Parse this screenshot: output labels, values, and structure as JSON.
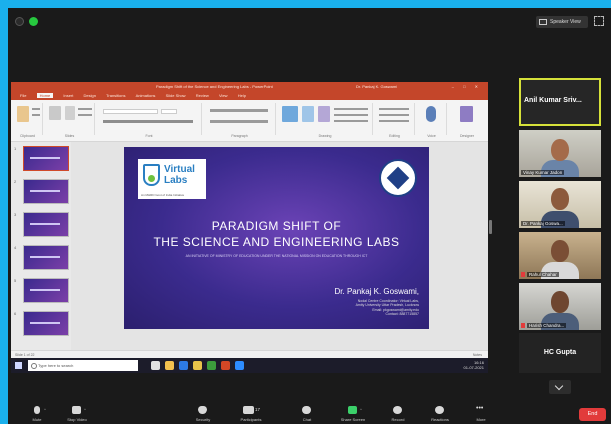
{
  "window": {
    "speaker_view_label": "Speaker View"
  },
  "powerpoint": {
    "doc_title": "Paradigm Shift of the Science and Engineering Labs - PowerPoint",
    "user": "Dr. Pankaj K. Goswami",
    "tabs": [
      "File",
      "Home",
      "Insert",
      "Design",
      "Transitions",
      "Animations",
      "Slide Show",
      "Review",
      "View",
      "Help"
    ],
    "active_tab": "Home",
    "ribbon_groups": [
      "Clipboard",
      "Slides",
      "Font",
      "Paragraph",
      "Drawing",
      "Editing",
      "Voice",
      "Designer"
    ],
    "status_left": "Slide 1 of 22",
    "status_right": "Notes",
    "thumb_numbers": [
      "1",
      "2",
      "3",
      "4",
      "5",
      "6"
    ]
  },
  "slide": {
    "logo_text_1": "Virtual",
    "logo_text_2": "Labs",
    "logo_caption": "An MHRD Govt of India Initiative",
    "title_line1": "PARADIGM SHIFT OF",
    "title_line2": "THE SCIENCE AND ENGINEERING LABS",
    "subtitle": "AN INITIATIVE OF MINISTRY OF EDUCATION UNDER THE NATIONAL MISSION ON EDUCATION THROUGH ICT",
    "presenter": "Dr. Pankaj K. Goswami,",
    "info1": "Nodal Centre Coordinator: Virtual Labs,",
    "info2": "Amity University Uttar Pradesh, Lucknow",
    "info3": "Email: pkgoswami@amity.edu",
    "info4": "Contact: 8887715857"
  },
  "taskbar": {
    "search_placeholder": "Type here to search",
    "time": "16:16",
    "date": "01-07-2021"
  },
  "participants": {
    "active_speaker": "Anil Kumar Sriv...",
    "tiles": [
      "Vinay Kumar Jadon",
      "Dr. Pankaj Goswa...",
      "Rahul Chahar",
      "Harish Chandra..."
    ],
    "last_tile": "HC Gupta"
  },
  "toolbar": {
    "mute": "Mute",
    "video": "Stop Video",
    "security": "Security",
    "participants": "Participants",
    "participants_count": "17",
    "chat": "Chat",
    "share": "Share Screen",
    "record": "Record",
    "reactions": "Reactions",
    "more": "More",
    "end": "End"
  },
  "colors": {
    "border_blue": "#1ab0ec",
    "powerpoint_orange": "#c4462a",
    "slide_purple": "#3b2b8e",
    "active_speaker_border": "#d6e13a",
    "end_red": "#e23b3b",
    "share_green": "#3bd06a"
  }
}
